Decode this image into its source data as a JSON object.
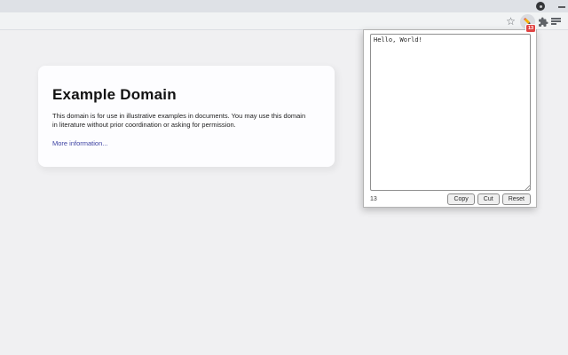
{
  "chrome": {
    "tabstrip": {
      "round_control": "profile-dot",
      "minimize": "dash"
    },
    "toolbar": {
      "star_glyph": "☆",
      "bookmark_icon": "star-outline",
      "extension_icon": "pencil",
      "extension_badge": "13",
      "extensions_icon": "puzzle-piece",
      "menu_icon": "list-lines",
      "toolbar_color": "#f1f3f4",
      "tabstrip_color": "#dee1e6"
    }
  },
  "webpage": {
    "background_color": "#f0f0f2",
    "card_background": "#fdfdff",
    "heading": "Example Domain",
    "paragraph": "This domain is for use in illustrative examples in documents. You may use this domain in literature without prior coordination or asking for permission.",
    "link_text": "More information...",
    "link_color": "#3e43a3"
  },
  "extension_popup": {
    "textarea_value": "Hello, World!",
    "char_count": "13",
    "buttons": [
      {
        "label": "Copy"
      },
      {
        "label": "Cut"
      },
      {
        "label": "Reset"
      }
    ]
  }
}
